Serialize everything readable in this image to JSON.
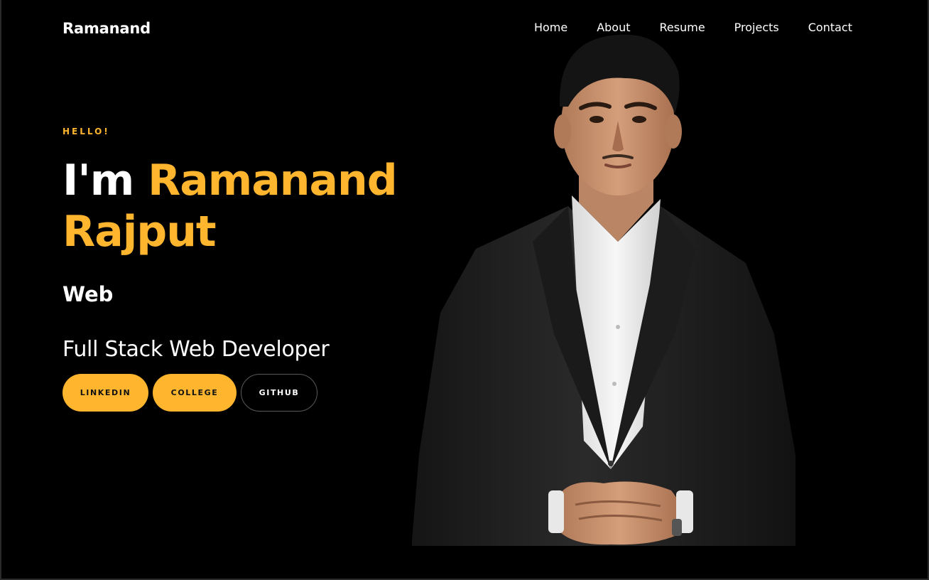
{
  "brand": "Ramanand",
  "nav": {
    "items": [
      "Home",
      "About",
      "Resume",
      "Projects",
      "Contact"
    ]
  },
  "hero": {
    "greeting": "HELLO!",
    "intro_prefix": "I'm",
    "name_line1": "Ramanand",
    "name_line2": "Rajput",
    "role": "Web",
    "subtitle": "Full Stack Web Developer",
    "buttons": {
      "linkedin": "LINKEDIN",
      "college": "COLLEGE",
      "github": "GITHUB"
    }
  },
  "colors": {
    "accent": "#ffb62e",
    "background": "#000000",
    "text": "#ffffff"
  },
  "portrait": {
    "icon": "person-portrait-photo"
  }
}
